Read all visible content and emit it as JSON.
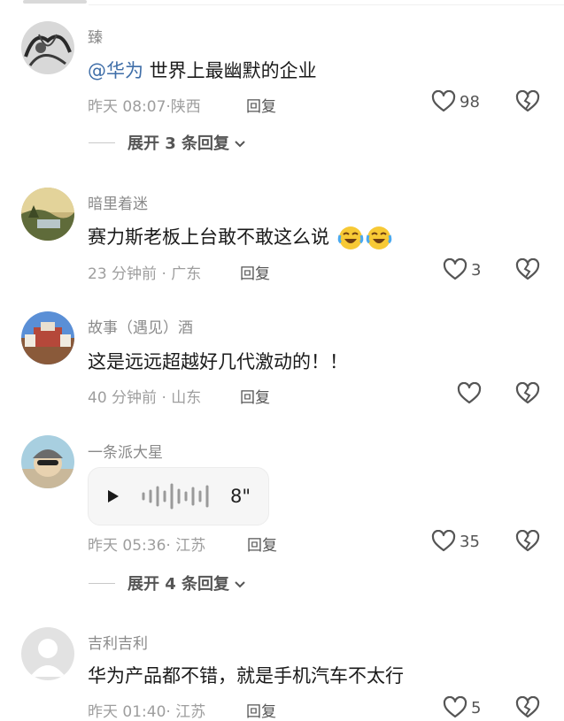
{
  "comments": [
    {
      "username": "臻",
      "mention": "@华为",
      "text": " 世界上最幽默的企业",
      "meta": "昨天 08:07·陕西",
      "reply_label": "回复",
      "likes": "98",
      "expand_label": "展开 3 条回复"
    },
    {
      "username": "暗里着迷",
      "text": "赛力斯老板上台敢不敢这么说",
      "meta": "23 分钟前 · 广东",
      "reply_label": "回复",
      "likes": "3"
    },
    {
      "username": "故事（遇见）酒",
      "text": "这是远远超越好几代激动的！！",
      "meta": "40 分钟前 · 山东",
      "reply_label": "回复",
      "likes": ""
    },
    {
      "username": "一条派大星",
      "voice_duration": "8\"",
      "meta": "昨天 05:36· 江苏",
      "reply_label": "回复",
      "likes": "35",
      "expand_label": "展开 4 条回复"
    },
    {
      "username": "吉利吉利",
      "text": "华为产品都不错，就是手机汽车不太行",
      "meta": "昨天 01:40· 江苏",
      "reply_label": "回复",
      "likes": "5"
    }
  ],
  "icons": {
    "like": "heart-outline-icon",
    "dislike": "broken-heart-icon",
    "expand": "chevron-down-icon",
    "play": "play-icon",
    "emoji": "laughing-crying-emoji"
  },
  "colors": {
    "mention": "#3f6ea8",
    "secondary_text": "#9e9e9e",
    "icon": "#555555"
  }
}
